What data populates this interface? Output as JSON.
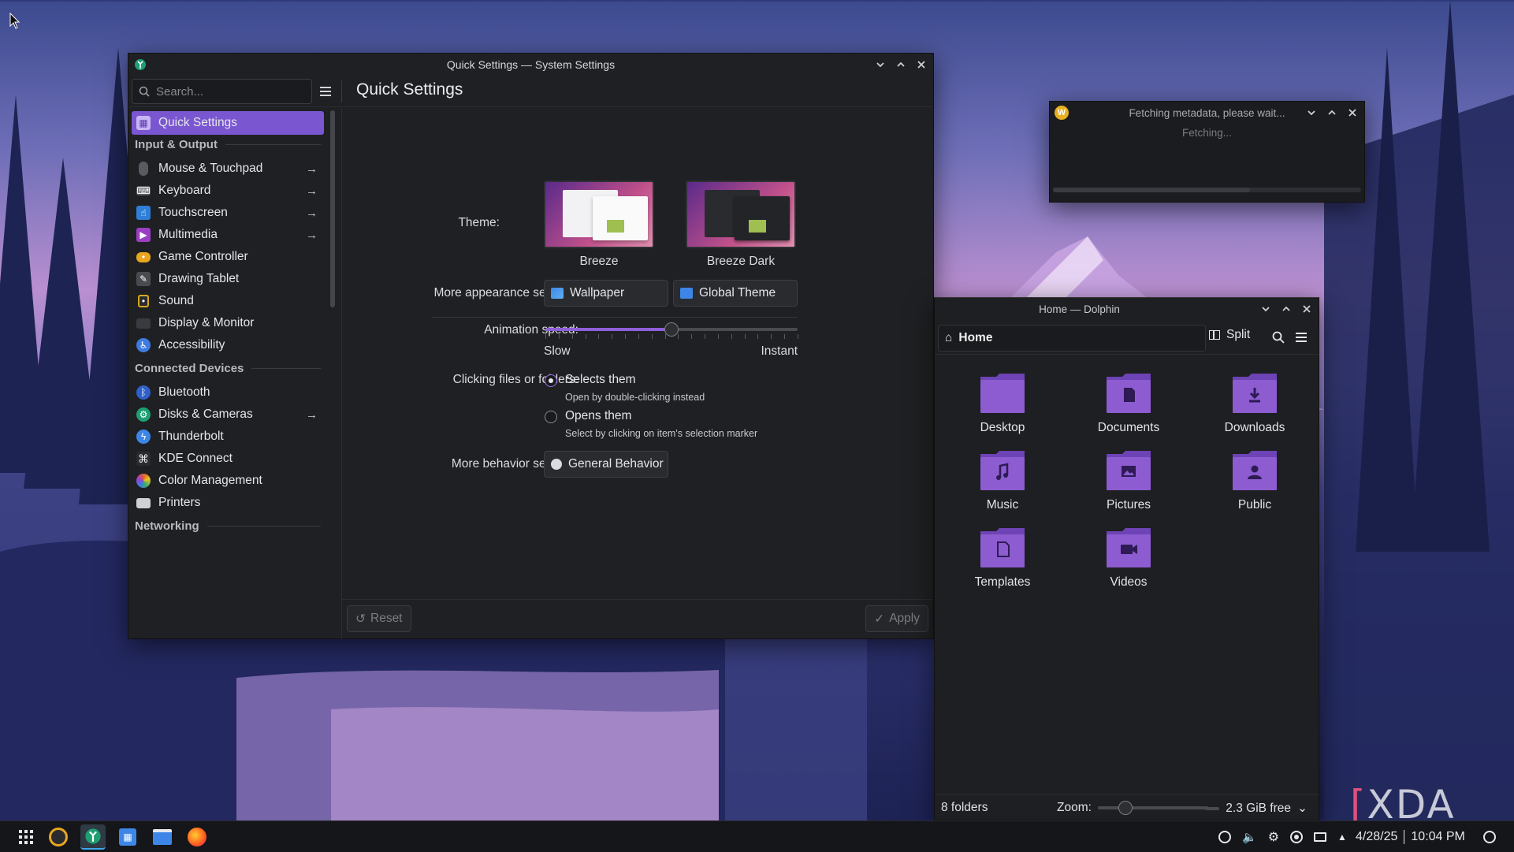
{
  "settings": {
    "window_title": "Quick Settings — System Settings",
    "search_placeholder": "Search...",
    "page_title": "Quick Settings",
    "sidebar": {
      "items": [
        {
          "label": "Quick Settings",
          "icon": "quick-settings-icon",
          "color": "#7a56d0"
        },
        {
          "label": "Mouse & Touchpad",
          "icon": "mouse-icon",
          "color": "#6a6b70"
        },
        {
          "label": "Keyboard",
          "icon": "keyboard-icon",
          "color": "#6a6b70"
        },
        {
          "label": "Touchscreen",
          "icon": "touchscreen-icon",
          "color": "#2f7fd8"
        },
        {
          "label": "Multimedia",
          "icon": "multimedia-icon",
          "color": "#9b3fc2"
        },
        {
          "label": "Game Controller",
          "icon": "gamepad-icon",
          "color": "#e8a620"
        },
        {
          "label": "Drawing Tablet",
          "icon": "tablet-icon",
          "color": "#4a4b50"
        },
        {
          "label": "Sound",
          "icon": "speaker-icon",
          "color": "#d9a81c"
        },
        {
          "label": "Display & Monitor",
          "icon": "monitor-icon",
          "color": "#3a3b40"
        },
        {
          "label": "Accessibility",
          "icon": "accessibility-icon",
          "color": "#3d7be0"
        },
        {
          "label": "Bluetooth",
          "icon": "bluetooth-icon",
          "color": "#2f5fc8"
        },
        {
          "label": "Disks & Cameras",
          "icon": "disks-icon",
          "color": "#1f9e72"
        },
        {
          "label": "Thunderbolt",
          "icon": "thunderbolt-icon",
          "color": "#3d86e8"
        },
        {
          "label": "KDE Connect",
          "icon": "kde-connect-icon",
          "color": "#d8d8dc"
        },
        {
          "label": "Color Management",
          "icon": "color-management-icon",
          "color": "#e0602f"
        },
        {
          "label": "Printers",
          "icon": "printer-icon",
          "color": "#cfcfd4"
        }
      ],
      "sections": [
        "Input & Output",
        "Connected Devices",
        "Networking"
      ]
    },
    "theme": {
      "label": "Theme:",
      "options": [
        "Breeze",
        "Breeze Dark"
      ]
    },
    "appearance": {
      "label": "More appearance settings:",
      "wallpaper": "Wallpaper",
      "global_theme": "Global Theme"
    },
    "animation": {
      "label": "Animation speed:",
      "min_label": "Slow",
      "max_label": "Instant",
      "value_fraction": 0.5
    },
    "clicking": {
      "label": "Clicking files or folders:",
      "option1": "Selects them",
      "option1_sub": "Open by double-clicking instead",
      "option2": "Opens them",
      "option2_sub": "Select by clicking on item's selection marker"
    },
    "behavior": {
      "label": "More behavior settings:",
      "button": "General Behavior"
    },
    "footer": {
      "reset": "Reset",
      "apply": "Apply"
    }
  },
  "notification": {
    "title": "Fetching metadata, please wait...",
    "status": "Fetching..."
  },
  "dolphin": {
    "window_title": "Home — Dolphin",
    "location": "Home",
    "split_label": "Split",
    "folders": [
      {
        "name": "Desktop",
        "icon": "desktop-folder-icon"
      },
      {
        "name": "Documents",
        "icon": "documents-folder-icon"
      },
      {
        "name": "Downloads",
        "icon": "downloads-folder-icon"
      },
      {
        "name": "Music",
        "icon": "music-folder-icon"
      },
      {
        "name": "Pictures",
        "icon": "pictures-folder-icon"
      },
      {
        "name": "Public",
        "icon": "public-folder-icon"
      },
      {
        "name": "Templates",
        "icon": "templates-folder-icon"
      },
      {
        "name": "Videos",
        "icon": "videos-folder-icon"
      }
    ],
    "status": {
      "count": "8 folders",
      "zoom_label": "Zoom:",
      "free_space": "2.3 GiB free"
    }
  },
  "taskbar": {
    "date": "4/28/25",
    "time": "10:04 PM"
  },
  "watermark": "XDA",
  "colors": {
    "accent": "#7a56d0",
    "folder": "#8c5cd0",
    "folder_dark": "#6d43b6"
  }
}
